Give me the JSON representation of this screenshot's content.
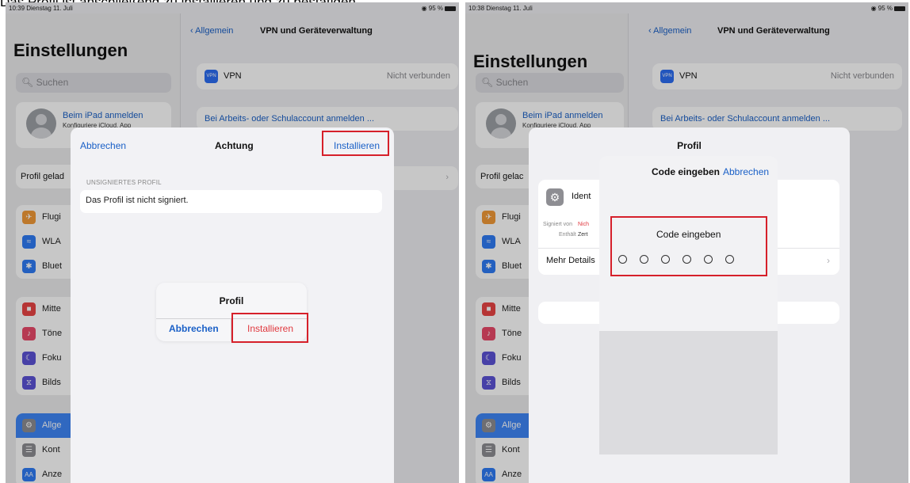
{
  "caption": "Das Profil ist anschließend zu installieren und zu bestätigen.",
  "left": {
    "status": {
      "time": "10:39  Dienstag 11. Juli",
      "battery": "95 %"
    },
    "sidebar": {
      "title": "Einstellungen",
      "search_placeholder": "Suchen",
      "account_name": "Beim iPad anmelden",
      "account_sub": "Konfiguriere iCloud, App",
      "profile_row": "Profil gelad",
      "group1": [
        "Flugi",
        "WLA",
        "Bluet"
      ],
      "group2": [
        "Mitte",
        "Töne",
        "Foku",
        "Bilds"
      ],
      "group3": [
        "Allge",
        "Kont",
        "Anze"
      ]
    },
    "nav": {
      "back": "Allgemein",
      "title": "VPN und Geräteverwaltung"
    },
    "vpn": {
      "label": "VPN",
      "status": "Nicht verbunden",
      "icon_text": "VPN"
    },
    "work_account": "Bei Arbeits- oder Schulaccount anmelden ...",
    "sheet": {
      "cancel": "Abbrechen",
      "title": "Achtung",
      "install": "Installieren",
      "section_label": "UNSIGNIERTES PROFIL",
      "note": "Das Profil ist nicht signiert."
    },
    "alert": {
      "title": "Profil",
      "cancel": "Abbrechen",
      "install": "Installieren"
    }
  },
  "right": {
    "status": {
      "time": "10:38  Dienstag 11. Juli",
      "battery": "95 %"
    },
    "sidebar": {
      "title": "Einstellungen",
      "search_placeholder": "Suchen",
      "account_name": "Beim iPad anmelden",
      "account_sub": "Konfiguriere iCloud, App",
      "profile_row": "Profil gelac",
      "group1": [
        "Flugi",
        "WLA",
        "Bluet"
      ],
      "group2": [
        "Mitte",
        "Töne",
        "Foku",
        "Bilds"
      ],
      "group3": [
        "Allge",
        "Kont",
        "Anze"
      ]
    },
    "nav": {
      "back": "Allgemein",
      "title": "VPN und Geräteverwaltung"
    },
    "vpn": {
      "label": "VPN",
      "status": "Nicht verbunden",
      "icon_text": "VPN"
    },
    "work_account": "Bei Arbeits- oder Schulaccount anmelden ...",
    "profile_sheet": {
      "title": "Profil",
      "ident": "Ident",
      "signed_by_label": "Signiert von",
      "signed_by_value": "Nich",
      "contains_label": "Enthält",
      "contains_value": "Zert",
      "more_details": "Mehr Details"
    },
    "code_sheet": {
      "title": "Code eingeben",
      "cancel": "Abbrechen",
      "prompt": "Code eingeben",
      "digits_entered": 0,
      "digits_total": 6
    }
  },
  "icons": {
    "airplane": "airplane-icon",
    "wifi": "wifi-icon",
    "bluetooth": "bluetooth-icon",
    "notifications": "notifications-icon",
    "sounds": "sounds-icon",
    "focus": "focus-icon",
    "screentime": "screen-time-icon",
    "general": "gear-icon",
    "control": "control-center-icon",
    "display": "display-icon"
  },
  "colors": {
    "accent": "#1a60c7",
    "destructive": "#e0383e",
    "highlight_box": "#d6202a",
    "selected_row": "#3e86f7"
  }
}
